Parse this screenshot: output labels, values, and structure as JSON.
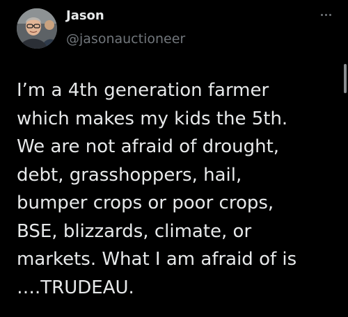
{
  "author": {
    "display_name": "Jason",
    "handle": "@jasonauctioneer",
    "avatar_icon": "profile-photo"
  },
  "menu": {
    "icon": "more-options-icon"
  },
  "tweet": {
    "lines": [
      "I’m a 4th generation farmer",
      "which makes my kids the 5th.",
      "We are not afraid of drought,",
      "debt, grasshoppers, hail,",
      "bumper crops or poor crops,",
      "BSE, blizzards, climate, or",
      "markets. What I am afraid of is",
      "….TRUDEAU."
    ]
  },
  "colors": {
    "background": "#000000",
    "text_primary": "#e7e9ea",
    "text_secondary": "#71767b"
  }
}
